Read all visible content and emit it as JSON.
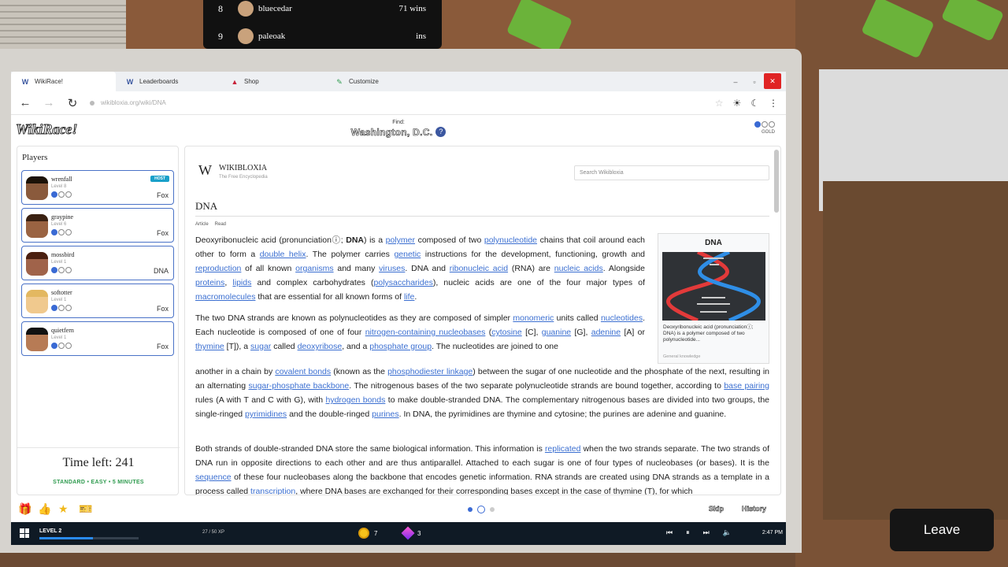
{
  "leaderboard": [
    {
      "rank": "8",
      "name": "bluecedar",
      "wins": "71 wins"
    },
    {
      "rank": "9",
      "name": "paleoak",
      "wins": "ins"
    }
  ],
  "browser": {
    "tabs": [
      {
        "label": "WikiRace!",
        "icon": "wiki-icon"
      },
      {
        "label": "Leaderboards",
        "icon": "wiki-icon"
      },
      {
        "label": "Shop",
        "icon": "shop-icon"
      },
      {
        "label": "Customize",
        "icon": "palette-icon"
      }
    ],
    "url": "wikibloxia.org/wiki/DNA"
  },
  "header": {
    "logo": "WikiRace!",
    "find_label": "Find:",
    "target": "Washington, D.C.",
    "help": "?",
    "rank_label": "GOLD"
  },
  "players_panel": {
    "title": "Players",
    "players": [
      {
        "name": "wrenfall",
        "level": "Level 8",
        "article": "Fox",
        "host": "HOST",
        "skin": "#8a5a3c",
        "hair": "#1c1208"
      },
      {
        "name": "graypine",
        "level": "Level 6",
        "article": "Fox",
        "host": "",
        "skin": "#9a6342",
        "hair": "#3a2112"
      },
      {
        "name": "mossbird",
        "level": "Level 1",
        "article": "DNA",
        "host": "",
        "skin": "#a0634a",
        "hair": "#4a1f10"
      },
      {
        "name": "softotter",
        "level": "Level 1",
        "article": "Fox",
        "host": "",
        "skin": "#f0c98e",
        "hair": "#e3b861"
      },
      {
        "name": "quietfern",
        "level": "Level 1",
        "article": "Fox",
        "host": "",
        "skin": "#b77b55",
        "hair": "#111111"
      }
    ],
    "time_left": "Time left: 241",
    "mode": "STANDARD • EASY • 5 MINUTES"
  },
  "article": {
    "site_name": "WIKIBLOXIA",
    "site_sub": "The Free Encyclopedia",
    "search_placeholder": "Search Wikibloxia",
    "title": "DNA",
    "tab_article": "Article",
    "tab_read": "Read",
    "infobox": {
      "title": "DNA",
      "caption": "Deoxyribonucleic acid (pronunciationⓘ; DNA) is a polymer composed of two polynucleotide...",
      "category": "General knowledge"
    }
  },
  "toolbar": {
    "skip": "Skip",
    "history": "History"
  },
  "taskbar": {
    "level": "LEVEL 2",
    "xp": "27 / 50 XP",
    "xp_fraction": 0.54,
    "coins": "7",
    "gems": "3",
    "clock": "2:47 PM"
  },
  "leave": "Leave"
}
